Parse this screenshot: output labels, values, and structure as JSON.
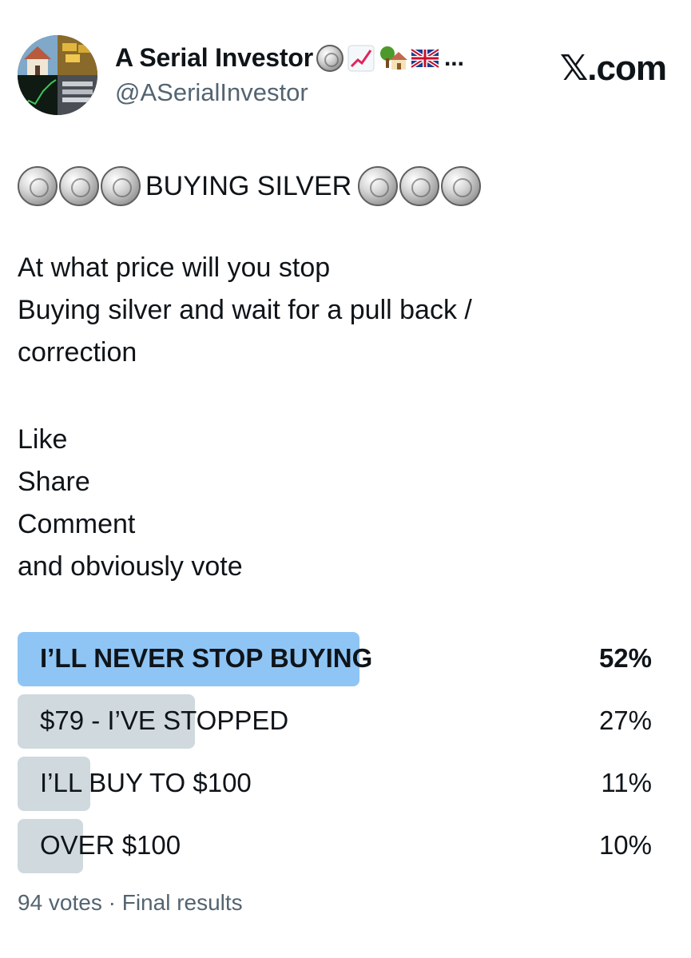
{
  "author": {
    "display_name": "A Serial Investor",
    "handle": "@ASerialInvestor",
    "name_emojis": [
      "silver-coin",
      "chart-increasing",
      "house-with-garden",
      "uk-flag"
    ],
    "name_truncation": "..."
  },
  "brand": "𝕏.com",
  "post": {
    "title": "BUYING SILVER",
    "body_lines": [
      "At what price will you stop",
      "Buying silver and wait for a pull back /",
      "correction"
    ],
    "cta_lines": [
      "Like",
      "Share",
      "Comment",
      "and obviously vote"
    ]
  },
  "poll": {
    "options": [
      {
        "label": "I’LL NEVER STOP BUYING",
        "percent_text": "52%",
        "percent": 52,
        "winner": true
      },
      {
        "label": "$79 - I’VE STOPPED",
        "percent_text": "27%",
        "percent": 27,
        "winner": false
      },
      {
        "label": "I’LL BUY TO $100",
        "percent_text": "11%",
        "percent": 11,
        "winner": false
      },
      {
        "label": "OVER $100",
        "percent_text": "10%",
        "percent": 10,
        "winner": false
      }
    ],
    "footer": "94 votes · Final results"
  },
  "colors": {
    "winner_bar": "#8ec5f5",
    "loser_bar": "#cfd9de",
    "secondary_text": "#536471"
  }
}
